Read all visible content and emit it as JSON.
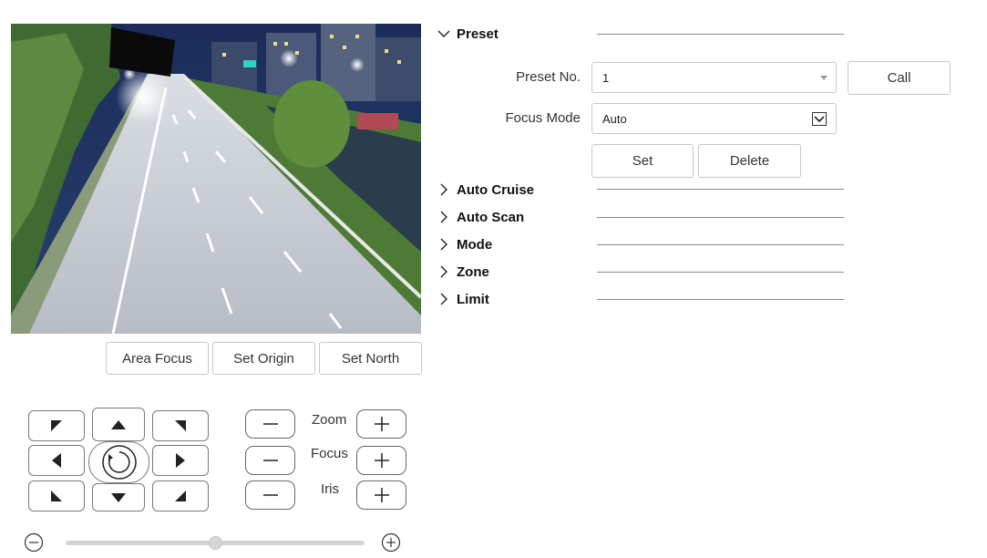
{
  "preview": {
    "buttons": {
      "area_focus": "Area Focus",
      "set_origin": "Set Origin",
      "set_north": "Set North"
    }
  },
  "ptz": {
    "labels": {
      "zoom": "Zoom",
      "focus": "Focus",
      "iris": "Iris"
    },
    "speed": {
      "value": 0.5
    },
    "icons": [
      "up-left",
      "up",
      "up-right",
      "left",
      "auto-rotate",
      "right",
      "down-left",
      "down",
      "down-right",
      "minus",
      "plus"
    ]
  },
  "preset": {
    "section_title": "Preset",
    "preset_no_label": "Preset No.",
    "preset_no_value": "1",
    "focus_mode_label": "Focus Mode",
    "focus_mode_value": "Auto",
    "call_button": "Call",
    "set_button": "Set",
    "delete_button": "Delete"
  },
  "sections": [
    "Auto Cruise",
    "Auto Scan",
    "Mode",
    "Zone",
    "Limit"
  ],
  "colors": {
    "border": "#c8c8c8",
    "ptz_border": "#7a7a7a",
    "divider": "#8a8a8a",
    "text": "#333333"
  }
}
